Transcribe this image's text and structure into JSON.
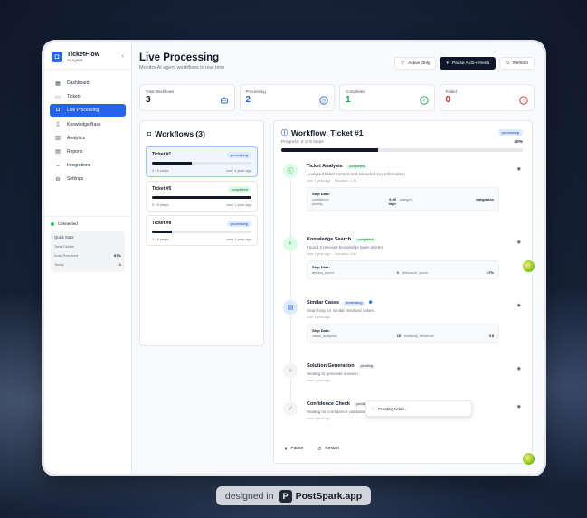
{
  "app": {
    "name": "TicketFlow",
    "subtitle": "AI Agent"
  },
  "sidebar": {
    "items": [
      {
        "label": "Dashboard",
        "icon": "grid-icon"
      },
      {
        "label": "Tickets",
        "icon": "ticket-icon"
      },
      {
        "label": "Live Processing",
        "icon": "bot-icon",
        "active": true
      },
      {
        "label": "Knowledge Base",
        "icon": "book-icon"
      },
      {
        "label": "Analytics",
        "icon": "chart-icon"
      },
      {
        "label": "Reports",
        "icon": "file-icon"
      },
      {
        "label": "Integrations",
        "icon": "plug-icon"
      },
      {
        "label": "Settings",
        "icon": "gear-icon"
      }
    ],
    "status": "Connected",
    "quick_stats": {
      "title": "Quick Stats",
      "rows": [
        {
          "label": "Total Tickets",
          "value": ""
        },
        {
          "label": "Auto-Resolved",
          "value": "87%"
        },
        {
          "label": "Today",
          "value": "1"
        }
      ]
    }
  },
  "header": {
    "title": "Live Processing",
    "subtitle": "Monitor AI agent workflows in real-time",
    "active_only": "Active Only",
    "pause": "Pause Auto-refresh",
    "refresh": "Refresh"
  },
  "stats": [
    {
      "label": "Total Workflows",
      "value": "3",
      "color": "#111827",
      "icon": "bot-icon"
    },
    {
      "label": "Processing",
      "value": "2",
      "color": "#2563eb",
      "icon": "clock-icon"
    },
    {
      "label": "Completed",
      "value": "1",
      "color": "#16a34a",
      "icon": "check-circle-icon"
    },
    {
      "label": "Failed",
      "value": "0",
      "color": "#dc2626",
      "icon": "alert-icon"
    }
  ],
  "workflows": {
    "title": "Workflows (3)",
    "items": [
      {
        "name": "Ticket #1",
        "status": "processing",
        "steps": "2 / 5 steps",
        "time": "over 1 year ago",
        "progress": 0.4
      },
      {
        "name": "Ticket #5",
        "status": "completed",
        "steps": "5 / 5 steps",
        "time": "over 1 year ago",
        "progress": 1.0
      },
      {
        "name": "Ticket #8",
        "status": "processing",
        "steps": "1 / 5 steps",
        "time": "over 1 year ago",
        "progress": 0.2
      }
    ]
  },
  "detail": {
    "title": "Workflow: Ticket #1",
    "status": "processing",
    "progress_text": "Progress: 2 of 5 steps",
    "progress_pct": "40%",
    "progress": 0.4,
    "steps": [
      {
        "title": "Ticket Analysis",
        "status": "completed",
        "desc": "Analyzed ticket content and extracted key information",
        "time": "over 1 year ago",
        "duration": "Duration: 1.2s",
        "data_title": "Step Data:",
        "data": [
          [
            "confidence:",
            "0.95",
            "category:",
            "integration"
          ],
          [
            "priority:",
            "high",
            "",
            ""
          ]
        ]
      },
      {
        "title": "Knowledge Search",
        "status": "completed",
        "desc": "Found 3 relevant knowledge base articles",
        "time": "over 1 year ago",
        "duration": "Duration: 2.5s",
        "data_title": "Step Data:",
        "data": [
          [
            "articles_found:",
            "3",
            "relevance_score:",
            "87%"
          ]
        ]
      },
      {
        "title": "Similar Cases",
        "status": "processing",
        "desc": "Searching for similar resolved cases...",
        "time": "over 1 year ago",
        "duration": "",
        "data_title": "Step Data:",
        "data": [
          [
            "cases_analyzed:",
            "15",
            "similarity_threshold:",
            "0.8"
          ]
        ]
      },
      {
        "title": "Solution Generation",
        "status": "pending",
        "desc": "Waiting to generate solution",
        "time": "over 1 year ago",
        "duration": ""
      },
      {
        "title": "Confidence Check",
        "status": "pending",
        "desc": "Waiting for confidence validation",
        "time": "over 1 year ago",
        "duration": ""
      }
    ],
    "pause": "Pause",
    "restart": "Restart"
  },
  "toast": "Creating ticket...",
  "footer": {
    "prefix": "designed in",
    "brand": "PostSpark.app"
  }
}
